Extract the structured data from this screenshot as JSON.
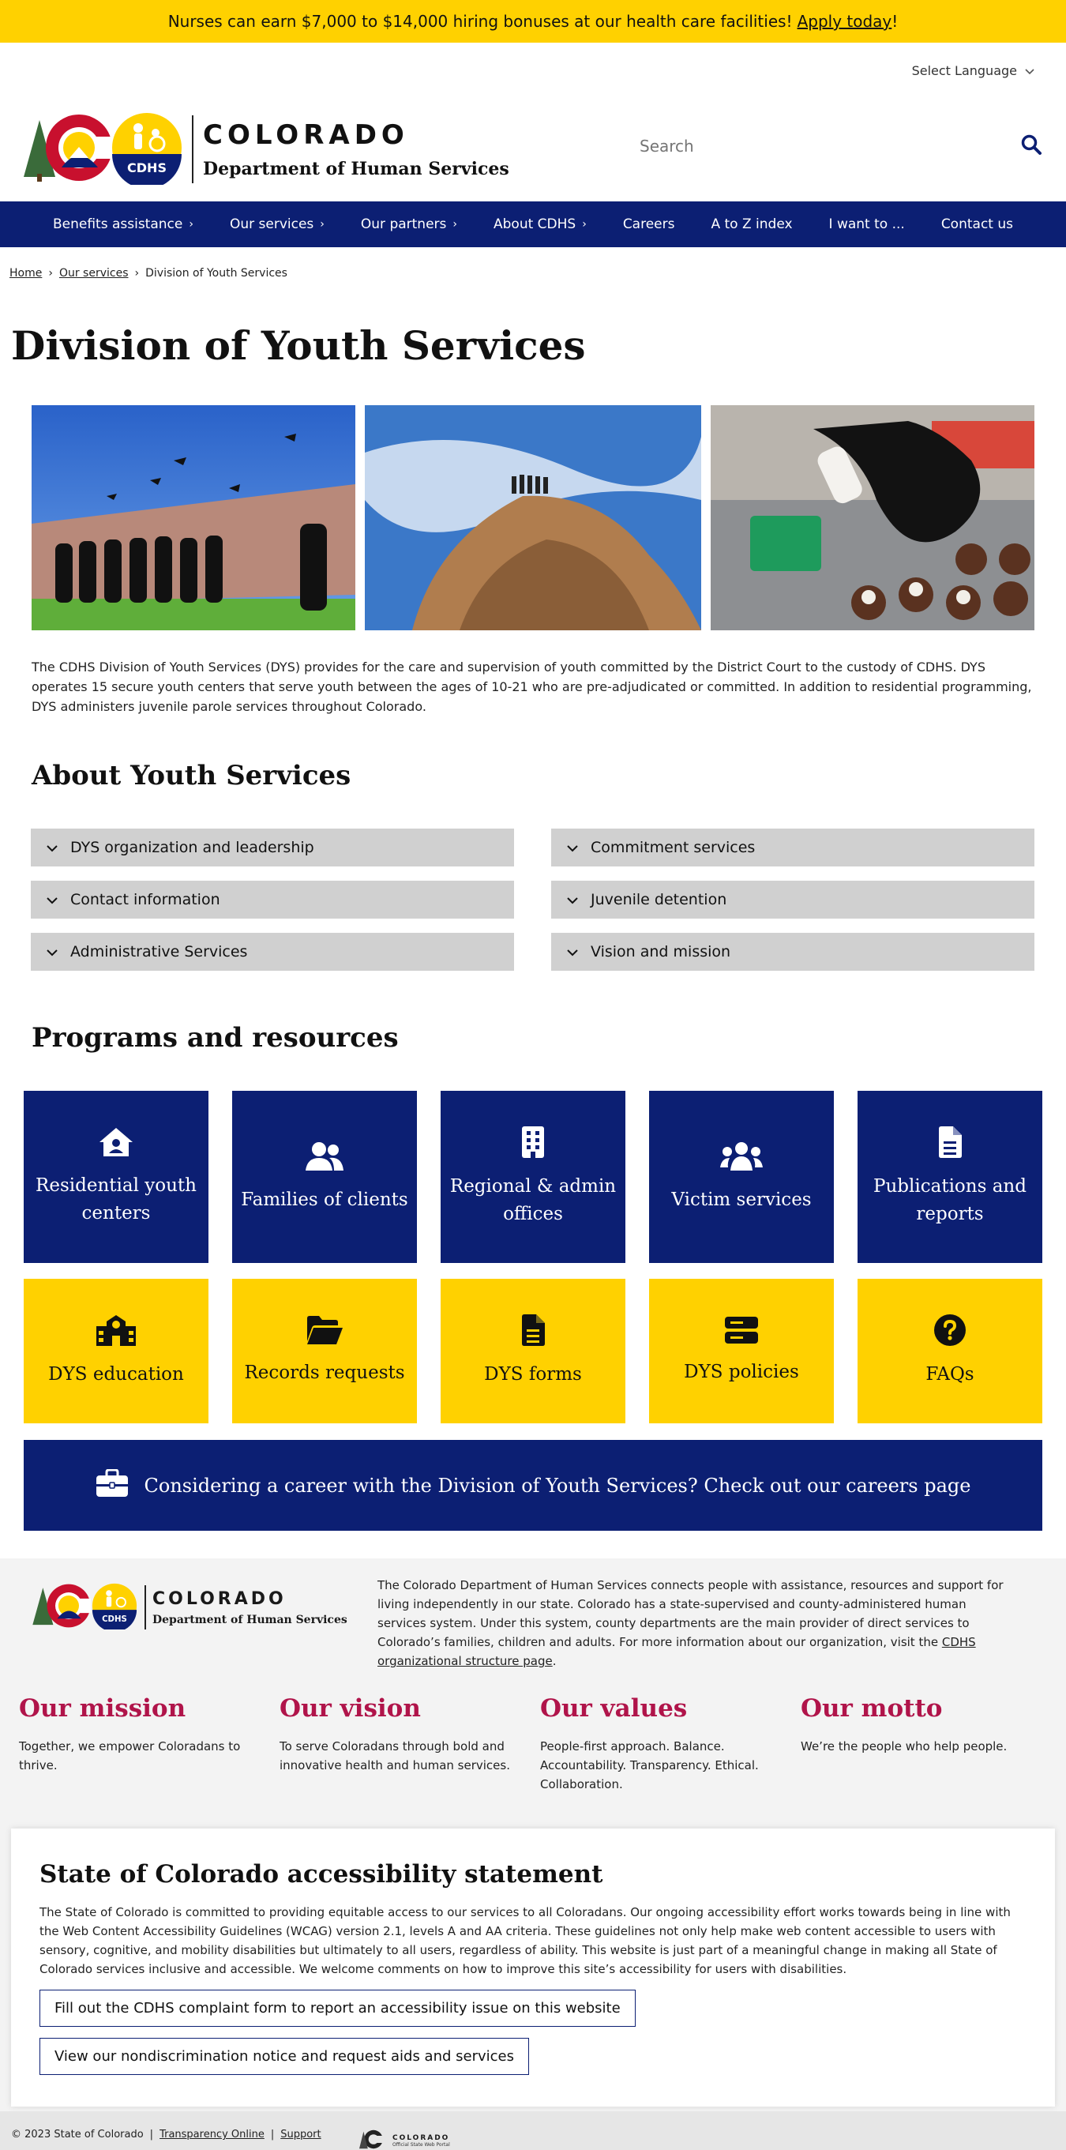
{
  "banner": {
    "text": "Nurses can earn $7,000 to $14,000 hiring bonuses at our health care facilities!",
    "link": "Apply today",
    "trail": "!"
  },
  "language": {
    "label": "Select Language"
  },
  "logo": {
    "state": "COLORADO",
    "department": "Department of Human Services",
    "badge": "CDHS"
  },
  "search": {
    "placeholder": "Search"
  },
  "nav": {
    "items": [
      {
        "label": "Benefits assistance",
        "chevron": "›"
      },
      {
        "label": "Our services",
        "chevron": "›"
      },
      {
        "label": "Our partners",
        "chevron": "›"
      },
      {
        "label": "About CDHS",
        "chevron": "›"
      },
      {
        "label": "Careers",
        "chevron": ""
      },
      {
        "label": "A to Z index",
        "chevron": ""
      },
      {
        "label": "I want to ...",
        "chevron": ""
      },
      {
        "label": "Contact us",
        "chevron": ""
      }
    ]
  },
  "breadcrumb": {
    "home": "Home",
    "services": "Our services",
    "current": "Division of Youth Services",
    "sep": "›"
  },
  "page": {
    "title": "Division of Youth Services",
    "intro": "The CDHS Division of Youth Services (DYS) provides for the care and supervision of youth committed by the District Court to the custody of CDHS. DYS operates 15 secure youth centers that serve youth between the ages of 10-21 who are pre-adjudicated or committed. In addition to residential programming, DYS administers juvenile parole services throughout Colorado."
  },
  "about": {
    "heading": "About Youth Services",
    "items": [
      "DYS organization and leadership",
      "Commitment services",
      "Contact information",
      "Juvenile detention",
      "Administrative Services",
      "Vision and mission"
    ]
  },
  "programs": {
    "heading": "Programs and resources",
    "blue": [
      {
        "label": "Residential youth centers",
        "icon": "house-user-icon"
      },
      {
        "label": "Families of clients",
        "icon": "users-icon"
      },
      {
        "label": "Regional & admin offices",
        "icon": "building-icon"
      },
      {
        "label": "Victim services",
        "icon": "user-group-icon"
      },
      {
        "label": "Publications and reports",
        "icon": "file-lines-icon"
      }
    ],
    "yellow": [
      {
        "label": "DYS education",
        "icon": "school-icon"
      },
      {
        "label": "Records requests",
        "icon": "folder-open-icon"
      },
      {
        "label": "DYS forms",
        "icon": "file-icon"
      },
      {
        "label": "DYS policies",
        "icon": "server-icon"
      },
      {
        "label": "FAQs",
        "icon": "question-circle-icon"
      }
    ]
  },
  "career": {
    "text": "Considering a career with the Division of Youth Services? Check out our careers page",
    "icon": "briefcase-icon"
  },
  "footer": {
    "desc": "The Colorado Department of Human Services connects people with assistance, resources and support for living independently in our state. Colorado has a state-supervised and county-administered human services system. Under this system, county departments are the main provider of direct services to Colorado’s families, children and adults. For more information about our organization, visit the",
    "desc_link": "CDHS organizational structure page",
    "desc_end": ".",
    "mission_title": "Our mission",
    "mission_text": "Together, we empower Coloradans to thrive.",
    "vision_title": "Our vision",
    "vision_text": "To serve Coloradans through bold and innovative health and human services.",
    "values_title": "Our values",
    "values_text": "People-first approach. Balance. Accountability. Transparency. Ethical. Collaboration.",
    "motto_title": "Our motto",
    "motto_text": "We’re the people who help people."
  },
  "accessibility": {
    "title": "State of Colorado accessibility statement",
    "text": "The State of Colorado is committed to providing equitable access to our services to all Coloradans. Our ongoing accessibility effort works towards being in line with the Web Content Accessibility Guidelines (WCAG) version 2.1, levels A and AA criteria. These guidelines not only help make web content accessible to users with sensory, cognitive, and mobility disabilities but ultimately to all users, regardless of ability. This website is just part of a meaningful change in making all State of Colorado services inclusive and accessible. We welcome comments on how to improve this site’s accessibility for users with disabilities.",
    "btn1": "Fill out the CDHS complaint form to report an accessibility issue on this website",
    "btn2": "View our nondiscrimination notice and request aids and services"
  },
  "bottom": {
    "copyright": "© 2023 State of Colorado",
    "sep": "|",
    "transparency": "Transparency Online",
    "support": "Support",
    "portal_state": "COLORADO",
    "portal_caption": "Official State Web Portal"
  },
  "colors": {
    "navy": "#0c1f73",
    "gold": "#ffd100",
    "crimson": "#b0144a",
    "gray": "#d0d0d0"
  }
}
